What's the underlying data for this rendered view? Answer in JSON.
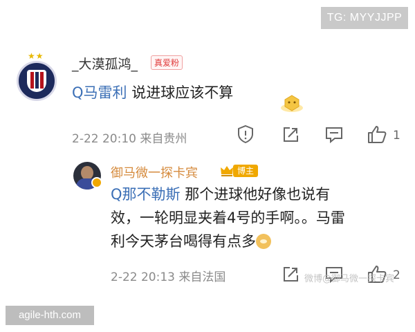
{
  "tg_badge": "TG: MYYJJPP",
  "comment": {
    "username": "_大漠孤鸿_",
    "badge": "真爱粉",
    "link": "Q马雷利",
    "text": "说进球应该不算",
    "time": "2-22 20:10",
    "location": "来自贵州",
    "like_count": "1"
  },
  "reply": {
    "username": "御马微一探卡宾",
    "badge": "博主",
    "link": "Q那不勒斯",
    "text_line1": "那个进球他好像也说有",
    "text_line2": "效，一轮明显夹着4号的手啊。。马雷",
    "text_line3": "利今天茅台喝得有点多",
    "time": "2-22 20:13",
    "location": "来自法国",
    "like_count": "2"
  },
  "watermark": "微博@御马微一探卡宾",
  "agile_badge": "agile-hth.com",
  "colors": {
    "link": "#3b6fb6",
    "host_badge": "#f0a800",
    "fan_badge": "#e03c3c",
    "meta_text": "#8a8a8a"
  },
  "icons": [
    "report-icon",
    "share-icon",
    "comment-icon",
    "like-icon",
    "sticker-icon",
    "crown-icon"
  ]
}
